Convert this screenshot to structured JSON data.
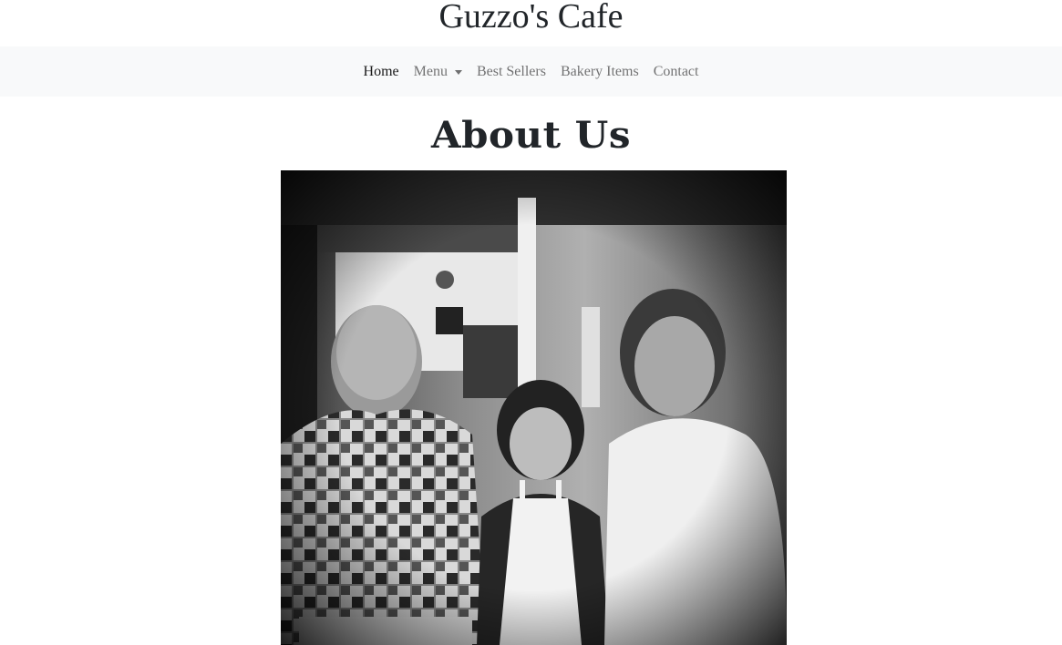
{
  "site": {
    "title": "Guzzo's Cafe"
  },
  "nav": {
    "items": [
      {
        "label": "Home",
        "active": true
      },
      {
        "label": "Menu",
        "dropdown": true
      },
      {
        "label": "Best Sellers"
      },
      {
        "label": "Bakery Items"
      },
      {
        "label": "Contact"
      }
    ]
  },
  "about": {
    "heading": "About Us",
    "photo_description_icon": "photo-of-three-bakers"
  },
  "colors": {
    "navbar_bg": "#f8f9fa",
    "text": "#212529",
    "nav_link": "#8c8c8c",
    "nav_link_active": "#1a1a1a"
  }
}
